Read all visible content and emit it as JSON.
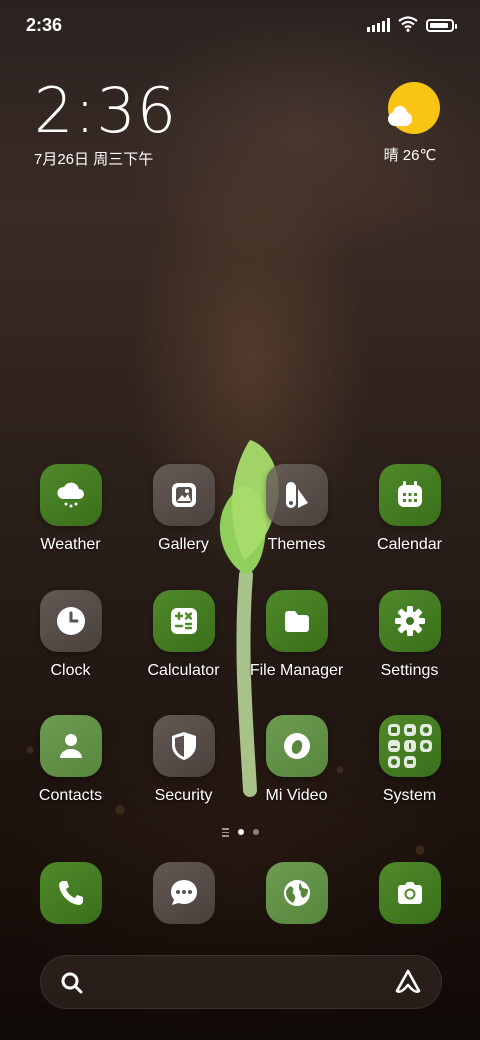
{
  "status_bar": {
    "time": "2:36",
    "icons": [
      "signal-icon",
      "wifi-icon",
      "battery-icon"
    ],
    "battery_level": 0.9
  },
  "clock_widget": {
    "time": "2:36",
    "date": "7月26日 周三下午"
  },
  "weather_widget": {
    "text": "晴 26℃",
    "icon": "sun-cloud-icon"
  },
  "apps": [
    {
      "label": "Weather",
      "icon": "weather-icon"
    },
    {
      "label": "Gallery",
      "icon": "gallery-icon"
    },
    {
      "label": "Themes",
      "icon": "themes-icon"
    },
    {
      "label": "Calendar",
      "icon": "calendar-icon"
    },
    {
      "label": "Clock",
      "icon": "clock-icon"
    },
    {
      "label": "Calculator",
      "icon": "calculator-icon"
    },
    {
      "label": "File Manager",
      "icon": "folder-icon"
    },
    {
      "label": "Settings",
      "icon": "gear-icon"
    },
    {
      "label": "Contacts",
      "icon": "contacts-icon"
    },
    {
      "label": "Security",
      "icon": "shield-icon"
    },
    {
      "label": "Mi Video",
      "icon": "video-icon"
    },
    {
      "label": "System",
      "icon": "folder-grid-icon"
    }
  ],
  "page_indicator": {
    "pages": 2,
    "current": 1
  },
  "dock": [
    {
      "icon": "phone-icon"
    },
    {
      "icon": "message-icon"
    },
    {
      "icon": "browser-icon"
    },
    {
      "icon": "camera-icon"
    }
  ],
  "search_bar": {
    "left_icon": "search-icon",
    "right_icon": "assistant-icon"
  },
  "colors": {
    "accent_green": "#4f8a2a",
    "sun": "#f9c414"
  }
}
